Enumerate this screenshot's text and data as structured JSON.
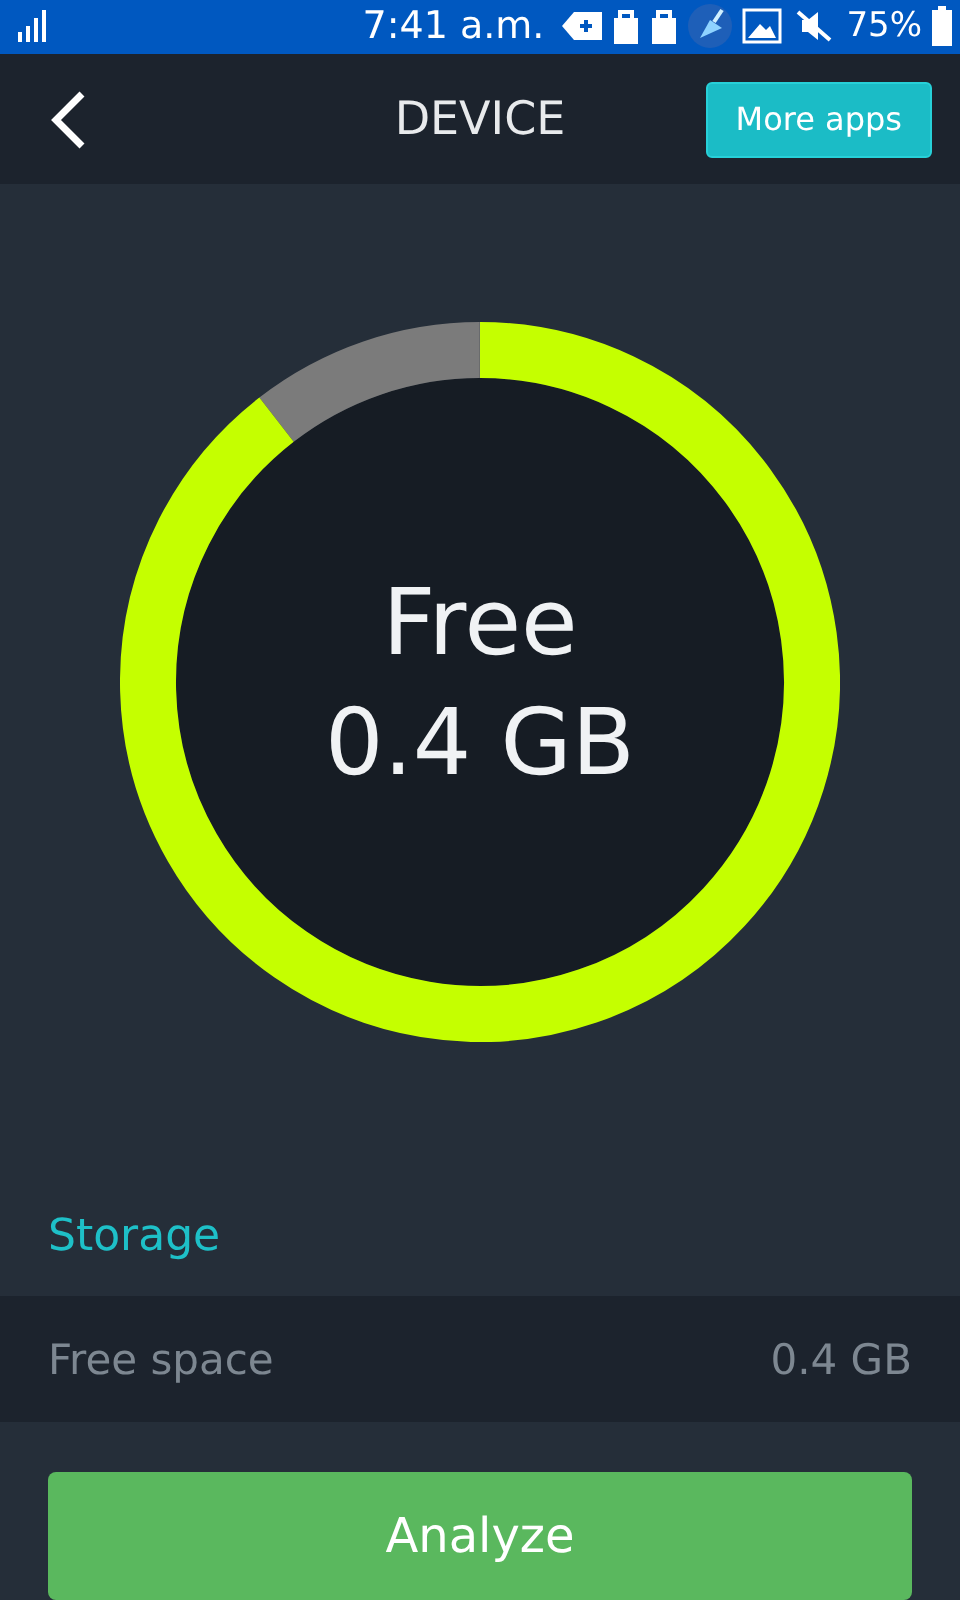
{
  "status_bar": {
    "time": "7:41 a.m.",
    "battery": "75%"
  },
  "header": {
    "title": "DEVICE",
    "action": "More apps"
  },
  "ring": {
    "label": "Free",
    "value": "0.4 GB"
  },
  "section": {
    "title": "Storage"
  },
  "rows": [
    {
      "label": "Free space",
      "value": "0.4 GB"
    }
  ],
  "button": {
    "label": "Analyze"
  }
}
